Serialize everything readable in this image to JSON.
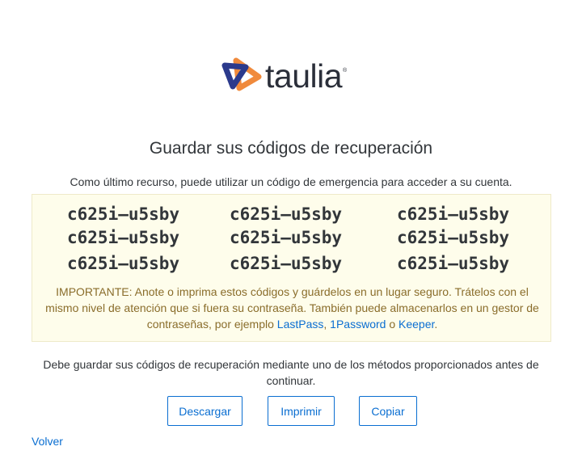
{
  "logo": {
    "text": "taulia",
    "reg": "®"
  },
  "title": "Guardar sus códigos de recuperación",
  "subtitle": "Como último recurso, puede utilizar un código de emergencia para acceder a su cuenta.",
  "codes": [
    "c625i–u5sby",
    "c625i–u5sby",
    "c625i–u5sby",
    "c625i–u5sby",
    "c625i–u5sby",
    "c625i–u5sby",
    "c625i–u5sby",
    "c625i–u5sby",
    "c625i–u5sby"
  ],
  "important": {
    "text": "IMPORTANTE: Anote o imprima estos códigos y guárdelos en un lugar seguro. Trátelos con el mismo nivel de atención que si fuera su contraseña. También puede almacenarlos en un gestor de contraseñas, por ejemplo ",
    "link1": "LastPass",
    "sep1": ", ",
    "link2": "1Password",
    "sep2": " o ",
    "link3": "Keeper",
    "end": "."
  },
  "must_save": "Debe guardar sus códigos de recuperación mediante uno de los métodos proporcionados antes de continuar.",
  "buttons": {
    "download": "Descargar",
    "print": "Imprimir",
    "copy": "Copiar"
  },
  "back_link": "Volver",
  "colors": {
    "accent": "#0a6ed1",
    "box_bg": "#fefdeb",
    "warning_text": "#8a6d2b",
    "logo_navy": "#2b3a8c",
    "logo_orange": "#f08a3c"
  }
}
